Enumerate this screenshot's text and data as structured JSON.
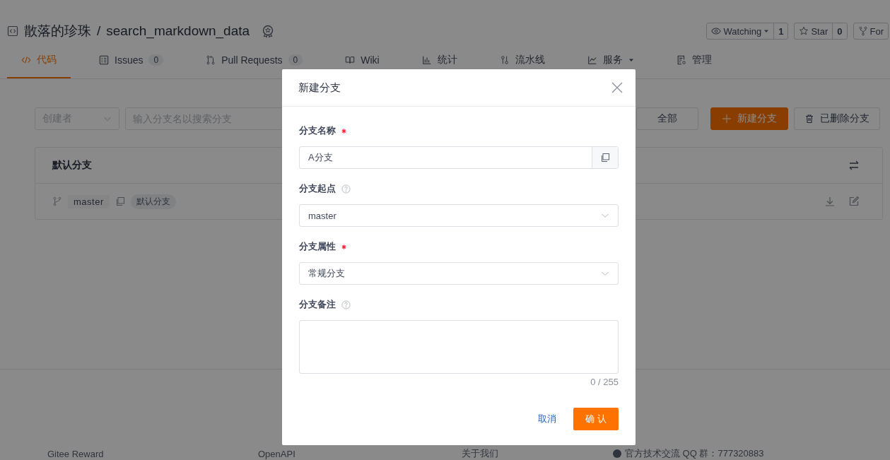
{
  "repo": {
    "owner": "散落的珍珠",
    "separator": "/",
    "name": "search_markdown_data"
  },
  "repo_actions": [
    {
      "kind": "watch",
      "label": "Watching",
      "count": "1"
    },
    {
      "kind": "star",
      "label": "Star",
      "count": "0"
    },
    {
      "kind": "fork",
      "label": "For"
    }
  ],
  "tabs": [
    {
      "kind": "code",
      "label": "代码",
      "selected": true
    },
    {
      "kind": "issues",
      "label": "Issues",
      "count": "0",
      "selected": false
    },
    {
      "kind": "pulls",
      "label": "Pull Requests",
      "count": "0",
      "selected": false
    },
    {
      "kind": "wiki",
      "label": "Wiki",
      "selected": false
    },
    {
      "kind": "stats",
      "label": "统计",
      "selected": false
    },
    {
      "kind": "pipeline",
      "label": "流水线",
      "selected": false
    },
    {
      "kind": "services",
      "label": "服务",
      "selected": false
    },
    {
      "kind": "manage",
      "label": "管理",
      "selected": false
    }
  ],
  "filters": {
    "creator": {
      "placeholder": "创建者"
    },
    "search": {
      "placeholder": "输入分支名以搜索分支"
    },
    "buttons": [
      {
        "kind": "plain",
        "label": "全部"
      },
      {
        "kind": "primary",
        "label": "新建分支"
      },
      {
        "kind": "deleted",
        "label": "已删除分支"
      }
    ]
  },
  "branches": {
    "title": "默认分支",
    "rows": [
      {
        "name": "master",
        "tag": "默认分支"
      }
    ]
  },
  "footer": [
    {
      "kind": "text",
      "label": "Gitee Reward"
    },
    {
      "kind": "text",
      "label": "OpenAPI"
    },
    {
      "kind": "text",
      "label": "关于我们"
    },
    {
      "kind": "qq",
      "label": "官方技术交流 QQ 群：777320883"
    }
  ],
  "dialog": {
    "title": "新建分支",
    "fields": [
      {
        "kind": "text",
        "label": "分支名称",
        "required": true,
        "help": false,
        "value": "A分支"
      },
      {
        "kind": "select",
        "label": "分支起点",
        "required": false,
        "help": true,
        "value": "master"
      },
      {
        "kind": "select",
        "label": "分支属性",
        "required": true,
        "help": false,
        "value": "常规分支"
      },
      {
        "kind": "textarea",
        "label": "分支备注",
        "required": false,
        "help": true,
        "counter": "0 / 255"
      }
    ],
    "cancel": "取消",
    "confirm": "确 认"
  }
}
